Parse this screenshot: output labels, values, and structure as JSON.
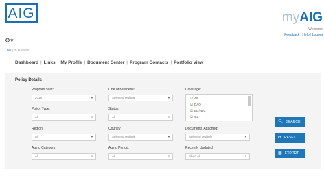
{
  "header": {
    "logo_text": "AIG",
    "brand_my": "my",
    "brand_aig": "AIG",
    "welcome": "Welcome",
    "links": [
      "Feedback",
      "Help",
      "Logout"
    ]
  },
  "breadcrumb": {
    "live": "Live",
    "in_review": "In Review"
  },
  "nav": [
    "Dashboard",
    "Links",
    "My Profile",
    "Document Center",
    "Program Contacts",
    "Portfolio View"
  ],
  "panel": {
    "title": "Policy Details"
  },
  "fields": {
    "program_year": {
      "label": "Program Year:",
      "value": "2018"
    },
    "line_of_business": {
      "label": "Line of Business:",
      "value": "Selected Multiple"
    },
    "coverage": {
      "label": "Coverage:",
      "items": [
        "All",
        "DAO",
        "EL / WC",
        "GL"
      ]
    },
    "policy_type": {
      "label": "Policy Type:",
      "value": "All"
    },
    "status": {
      "label": "Status:",
      "value": "All"
    },
    "region": {
      "label": "Region:",
      "value": "All"
    },
    "country": {
      "label": "Country:",
      "value": "Selected Multiple"
    },
    "documents_attached": {
      "label": "Documents Attached:",
      "value": "Selected Multiple"
    },
    "aging_category": {
      "label": "Aging Category:",
      "value": "All"
    },
    "aging_period": {
      "label": "Aging Period:",
      "value": "All"
    },
    "recently_updated": {
      "label": "Recently Updated:",
      "value": "Show All"
    }
  },
  "buttons": {
    "search": "SEARCH",
    "reset": "RESET",
    "export": "EXPORT"
  },
  "colors": {
    "brand_blue": "#1a6fb5",
    "button_blue": "#1f77b8",
    "panel_bg": "#f4f4f4"
  }
}
